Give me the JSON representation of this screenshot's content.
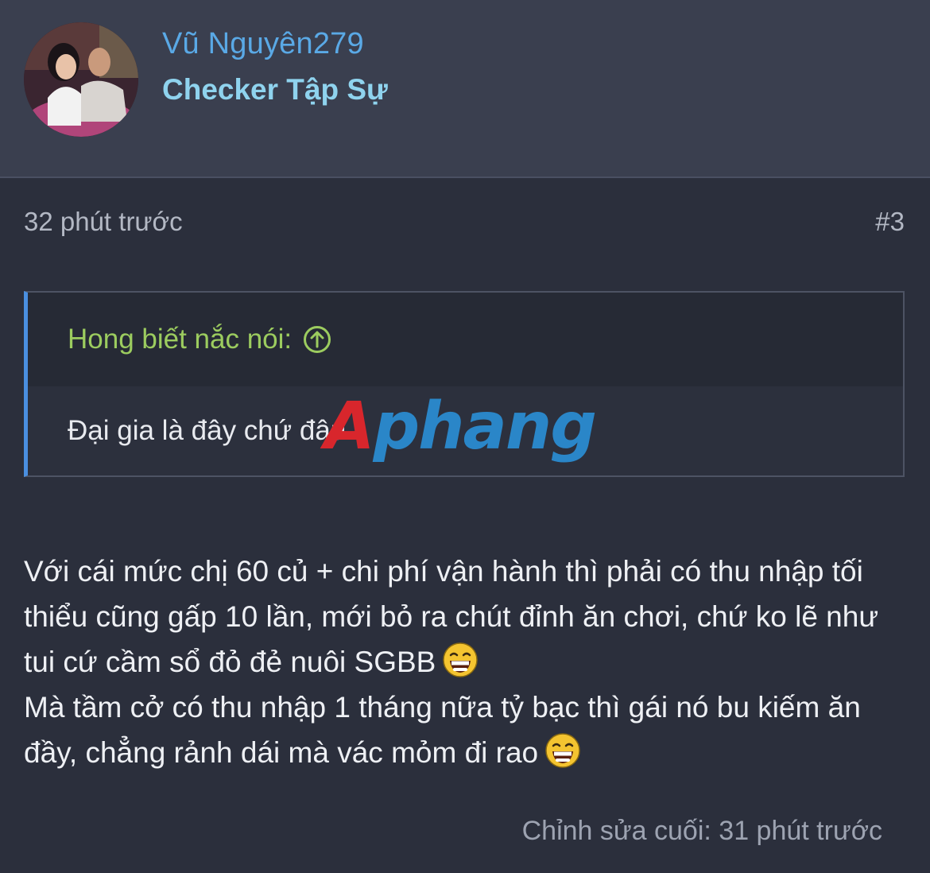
{
  "user": {
    "name": "Vũ Nguyên279",
    "title": "Checker Tập Sự"
  },
  "post": {
    "time": "32 phút trước",
    "number": "#3",
    "quote": {
      "author": "Hong biết nắc nói:",
      "text": "Đại gia là đây chứ đâu"
    },
    "message": {
      "paragraph1": "Với cái mức chị 60 củ + chi phí vận hành thì phải có thu nhập tối thiểu cũng gấp 10 lần, mới bỏ ra chút đỉnh ăn chơi, chứ ko lẽ như tui cứ cầm sổ đỏ đẻ nuôi SGBB",
      "paragraph2": "Mà tầm cở có thu nhập 1 tháng nữa tỷ bạc thì gái nó bu kiếm ăn đầy, chẳng rảnh dái mà vác mỏm đi rao"
    },
    "edited": "Chỉnh sửa cuối: 31 phút trước"
  },
  "watermark": {
    "first_letter": "A",
    "rest": "phang"
  },
  "icons": {
    "quote_jump": "circle-arrow-up-icon",
    "emoji": "laughing-emoji-icon"
  },
  "colors": {
    "background": "#2b2f3c",
    "header": "#3a3f4f",
    "username": "#5aa9e6",
    "usertitle": "#8fd3ee",
    "quote_author": "#9ccc5f",
    "quote_border": "#4a8fe0"
  }
}
